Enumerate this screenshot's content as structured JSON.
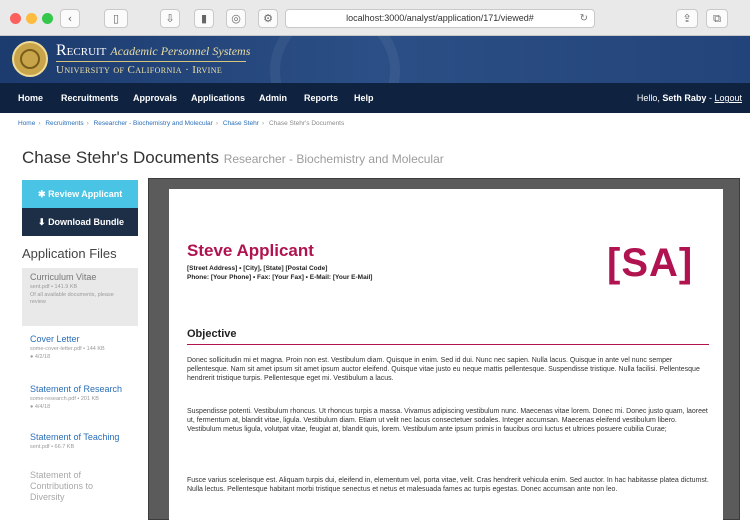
{
  "browser": {
    "url": "localhost:3000/analyst/application/171/viewed#"
  },
  "header": {
    "app_name_main": "Recruit",
    "app_name_sub": "Academic Personnel Systems",
    "org_name": "University of California · Irvine"
  },
  "nav": {
    "items": [
      "Home",
      "Recruitments",
      "Approvals",
      "Applications",
      "Admin",
      "Reports",
      "Help"
    ],
    "greeting": "Hello,",
    "user": "Seth Raby",
    "logout": "Logout"
  },
  "breadcrumb": {
    "items": [
      "Home",
      "Recruitments",
      "Researcher - Biochemistry and Molecular",
      "Chase Stehr"
    ],
    "current": "Chase Stehr's Documents"
  },
  "page": {
    "title": "Chase Stehr's Documents",
    "subtitle": "Researcher - Biochemistry and Molecular"
  },
  "sidebar": {
    "review_button": "Review Applicant",
    "download_button": "Download Bundle",
    "files_title": "Application Files",
    "files": [
      {
        "name": "Curriculum Vitae",
        "meta1": "sent.pdf • 141.9 KB",
        "meta2": "Of all available documents, please review"
      },
      {
        "name": "Cover Letter",
        "meta1": "some-cover-letter.pdf • 144 KB",
        "meta2": "● 4/2/18"
      },
      {
        "name": "Statement of Research",
        "meta1": "some-research.pdf • 201 KB",
        "meta2": "● 4/4/18"
      },
      {
        "name": "Statement of Teaching",
        "meta1": "sent.pdf • 66.7 KB",
        "meta2": ""
      },
      {
        "name": "Statement of Contributions to Diversity",
        "meta1": "",
        "meta2": ""
      }
    ]
  },
  "document": {
    "name": "Steve Applicant",
    "address": "[Street Address] • [City], [State] [Postal Code]",
    "contact": "Phone: [Your Phone] • Fax: [Your Fax] • E-Mail: [Your E-Mail]",
    "initials": "[SA]",
    "section_title": "Objective",
    "paragraphs": [
      "Donec sollicitudin mi et magna. Proin non est. Vestibulum diam. Quisque in enim. Sed id dui. Nunc nec sapien. Nulla lacus. Quisque in ante vel nunc semper pellentesque. Nam sit amet ipsum sit amet ipsum auctor eleifend. Quisque vitae justo eu neque mattis pellentesque. Suspendisse tristique. Nulla facilisi. Pellentesque hendrerit tristique turpis. Pellentesque eget mi. Vestibulum a lacus.",
      "Suspendisse potenti. Vestibulum rhoncus. Ut rhoncus turpis a massa. Vivamus adipiscing vestibulum nunc. Maecenas vitae lorem. Donec mi. Donec justo quam, laoreet ut, fermentum at, blandit vitae, ligula. Vestibulum diam. Etiam ut velit nec lacus consectetuer sodales. Integer accumsan. Maecenas eleifend vestibulum libero. Vestibulum metus ligula, volutpat vitae, feugiat at, blandit quis, lorem. Vestibulum ante ipsum primis in faucibus orci luctus et ultrices posuere cubilia Curae;",
      "Fusce varius scelerisque est. Aliquam turpis dui, eleifend in, elementum vel, porta vitae, velit. Cras hendrerit vehicula enim. Sed auctor. In hac habitasse platea dictumst. Nulla lectus. Pellentesque habitant morbi tristique senectus et netus et malesuada fames ac turpis egestas. Donec accumsan ante non leo."
    ]
  },
  "colors": {
    "brand_blue": "#1c3b6e",
    "nav_dark": "#0f2340",
    "accent_cyan": "#4ac4e4",
    "resume_crimson": "#b0134f",
    "link_blue": "#2b6fb8"
  }
}
